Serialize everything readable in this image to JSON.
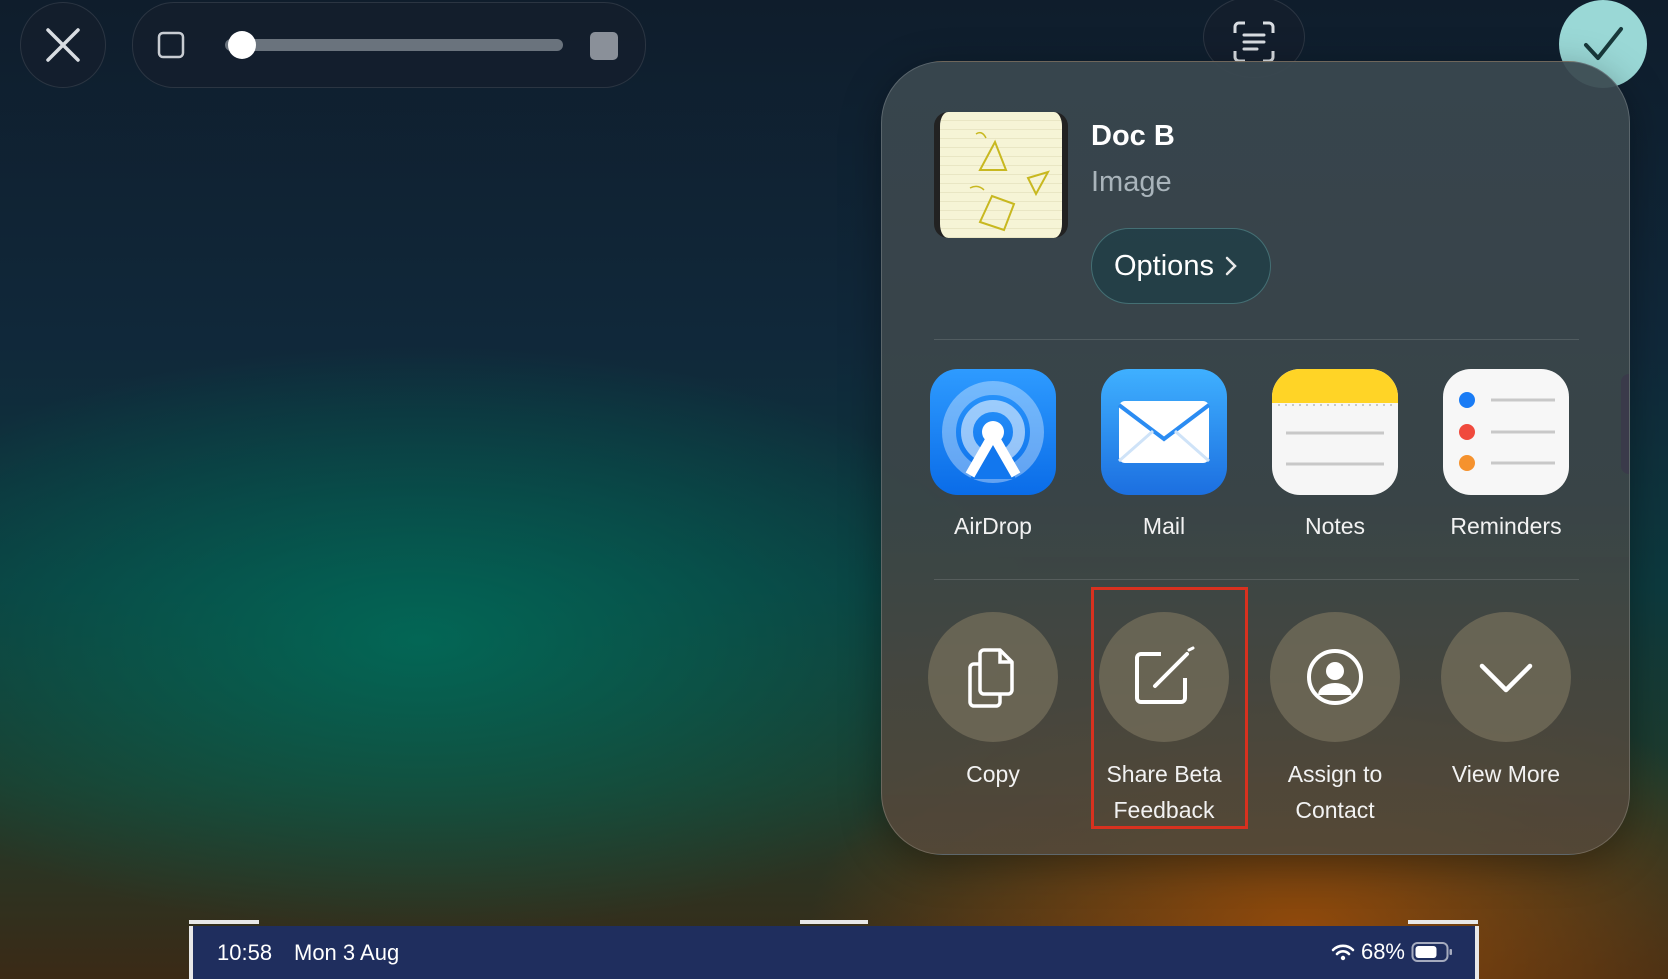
{
  "toolbar": {
    "close_icon": "close-icon",
    "slider": {
      "level": 0.05,
      "min_icon": "small-square-icon",
      "max_icon": "large-square-icon"
    },
    "scan_icon": "scan-text-icon",
    "done_icon": "checkmark-icon"
  },
  "share_sheet": {
    "doc_title": "Doc B",
    "doc_subtitle": "Image",
    "options_label": "Options",
    "apps": [
      {
        "label": "AirDrop",
        "icon": "airdrop-icon"
      },
      {
        "label": "Mail",
        "icon": "mail-icon"
      },
      {
        "label": "Notes",
        "icon": "notes-icon"
      },
      {
        "label": "Reminders",
        "icon": "reminders-icon"
      }
    ],
    "actions": [
      {
        "label": "Copy",
        "icon": "copy-icon"
      },
      {
        "label": "Share Beta Feedback",
        "icon": "compose-icon",
        "highlighted": true
      },
      {
        "label": "Assign to Contact",
        "icon": "contact-icon"
      },
      {
        "label": "View More",
        "icon": "chevron-down-icon"
      }
    ]
  },
  "status_bar": {
    "time": "10:58",
    "date": "Mon 3 Aug",
    "battery": "68%"
  },
  "colors": {
    "accent_done": "#9ad8d6",
    "highlight_border": "#d8311f",
    "status_bar_bg": "#1f2e5e"
  }
}
